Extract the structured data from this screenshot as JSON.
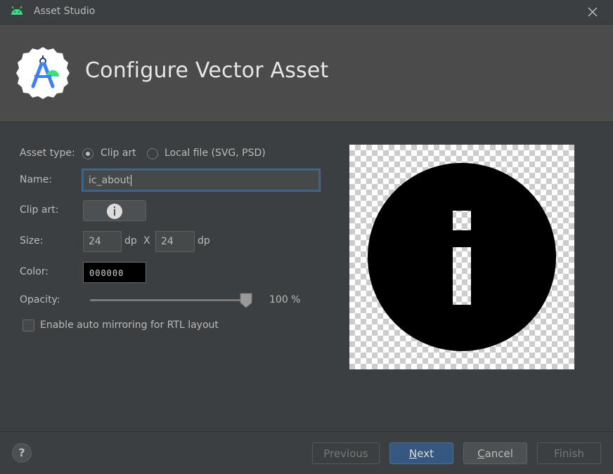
{
  "window": {
    "title": "Asset Studio",
    "icon": "android-icon",
    "close_icon": "close-icon"
  },
  "header": {
    "title": "Configure Vector Asset",
    "logo": "android-studio-logo"
  },
  "form": {
    "asset_type": {
      "label": "Asset type:",
      "options": [
        {
          "label": "Clip art",
          "selected": true
        },
        {
          "label": "Local file (SVG, PSD)",
          "selected": false
        }
      ]
    },
    "name": {
      "label": "Name:",
      "value": "ic_about"
    },
    "clip_art": {
      "label": "Clip art:",
      "icon": "info-icon"
    },
    "size": {
      "label": "Size:",
      "width": "24",
      "height": "24",
      "unit": "dp",
      "separator": "X"
    },
    "color": {
      "label": "Color:",
      "value": "000000"
    },
    "opacity": {
      "label": "Opacity:",
      "value": 100,
      "display": "100 %"
    },
    "rtl": {
      "label": "Enable auto mirroring for RTL layout",
      "checked": false
    }
  },
  "preview": {
    "icon": "info-icon",
    "fill": "#000000"
  },
  "footer": {
    "help": "?",
    "buttons": {
      "previous": {
        "label": "Previous",
        "enabled": false
      },
      "next": {
        "label_pre": "",
        "mnemonic": "N",
        "label_post": "ext",
        "enabled": true
      },
      "cancel": {
        "label_pre": "",
        "mnemonic": "C",
        "label_post": "ancel",
        "enabled": true
      },
      "finish": {
        "label": "Finish",
        "enabled": false
      }
    }
  },
  "colors": {
    "background": "#3c3f41",
    "header_background": "#4b4b4b",
    "accent": "#365880"
  }
}
